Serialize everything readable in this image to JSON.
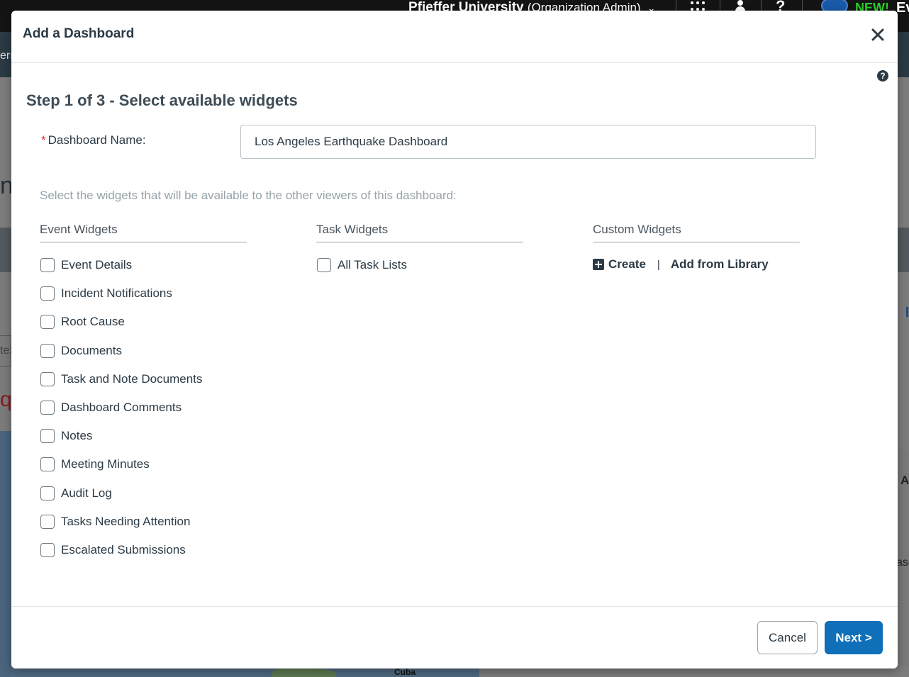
{
  "background": {
    "org_name": "Pfieffer University",
    "org_role": "(Organization Admin)",
    "new_badge": "NEW!",
    "user_trunc": "Ev",
    "nav_trunc": "ers",
    "input_trunc": "tex",
    "heading_trunc": "qu",
    "map_label": "Cuba",
    "right_trunc_a": "A",
    "right_trunc_ase": "ase"
  },
  "modal": {
    "title": "Add a Dashboard",
    "step_title": "Step 1 of 3 - Select available widgets",
    "name_label": "Dashboard Name:",
    "required_mark": "*",
    "name_value": "Los Angeles Earthquake Dashboard",
    "hint": "Select the widgets that will be available to the other viewers of this dashboard:",
    "columns": {
      "event": {
        "heading": "Event Widgets",
        "items": [
          {
            "label": "Event Details",
            "checked": false
          },
          {
            "label": "Incident Notifications",
            "checked": false
          },
          {
            "label": "Root Cause",
            "checked": false
          },
          {
            "label": "Documents",
            "checked": false
          },
          {
            "label": "Task and Note Documents",
            "checked": false
          },
          {
            "label": "Dashboard Comments",
            "checked": false
          },
          {
            "label": "Notes",
            "checked": false
          },
          {
            "label": "Meeting Minutes",
            "checked": false
          },
          {
            "label": "Audit Log",
            "checked": false
          },
          {
            "label": "Tasks Needing Attention",
            "checked": false
          },
          {
            "label": "Escalated Submissions",
            "checked": false
          }
        ]
      },
      "task": {
        "heading": "Task Widgets",
        "items": [
          {
            "label": "All Task Lists",
            "checked": false
          }
        ]
      },
      "custom": {
        "heading": "Custom Widgets",
        "create_label": "Create",
        "separator": "|",
        "library_label": "Add from Library"
      }
    },
    "footer": {
      "cancel_label": "Cancel",
      "next_label": "Next >"
    }
  },
  "colors": {
    "primary": "#0f6fb8",
    "text_dark": "#2b3a45",
    "hint_text": "#97a3ab",
    "required": "#d9342b"
  }
}
